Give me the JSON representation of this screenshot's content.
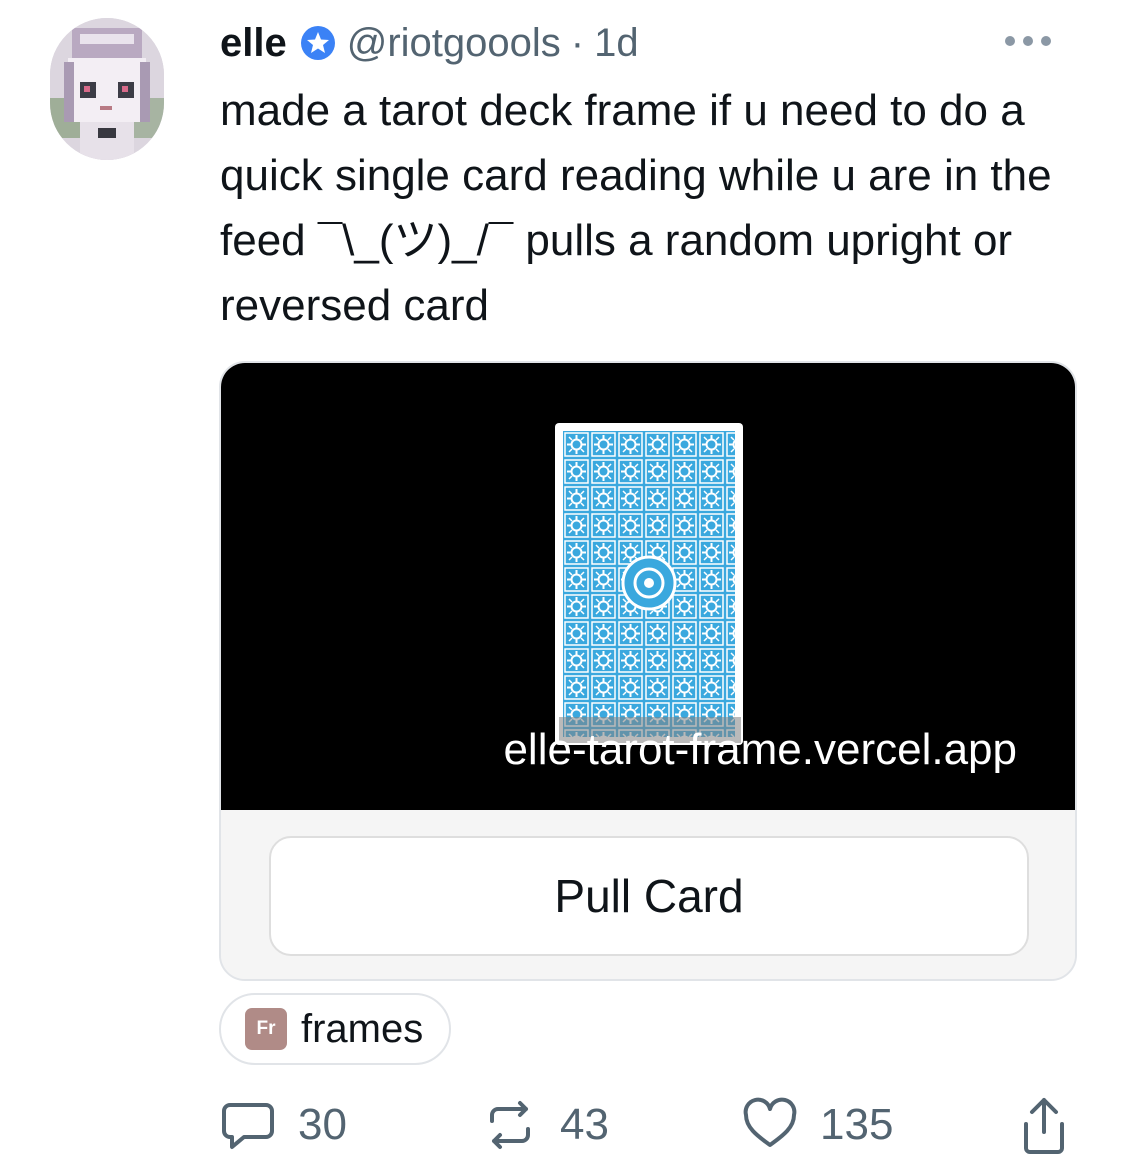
{
  "author": {
    "name": "elle",
    "handle": "@riotgoools",
    "separator": "·",
    "time": "1d",
    "avatar_icon": "pixel-art-avatar",
    "verified_icon": "verified-badge-icon",
    "verified_color": "#3b82f6"
  },
  "post": {
    "text": "made a tarot deck frame if u need to do a quick single card reading while u are in the feed ¯\\_(ツ)_/¯ pulls a random upright or reversed card"
  },
  "frame": {
    "url": "elle-tarot-frame.vercel.app",
    "button_label": "Pull Card",
    "card_color": "#3aa8de"
  },
  "channel": {
    "badge": "Fr",
    "name": "frames",
    "badge_color": "#b08b87"
  },
  "actions": {
    "replies": "30",
    "recasts": "43",
    "likes": "135",
    "reply_icon": "comment-icon",
    "recast_icon": "recast-icon",
    "like_icon": "heart-icon",
    "share_icon": "share-icon"
  },
  "more_icon": "more-options-icon"
}
